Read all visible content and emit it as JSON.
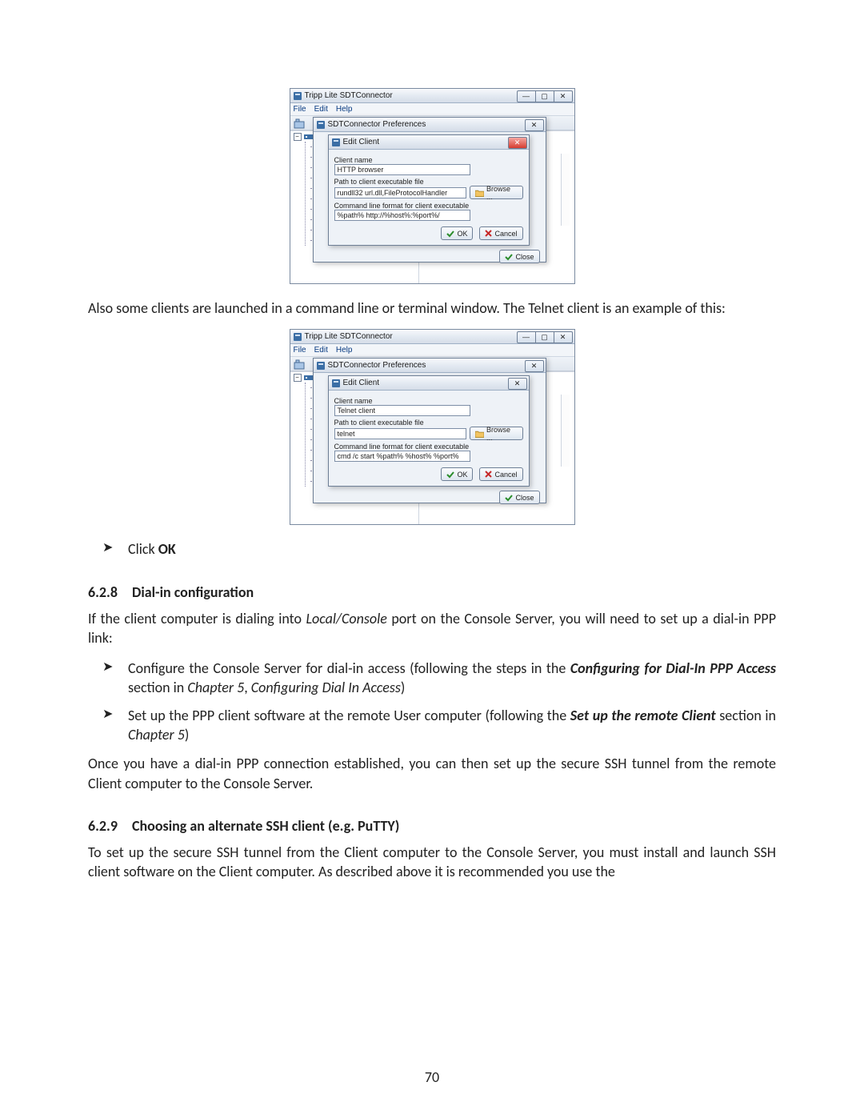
{
  "page_number": "70",
  "text": {
    "para1": "Also some clients are launched in a command line or terminal window. The Telnet client is an example of this:",
    "click_prefix": "Click ",
    "click_bold": "OK",
    "para2_a": "If the client computer is dialing into ",
    "para2_italic": "Local/Console",
    "para2_b": " port on the Console Server, you will need to set up a dial-in PPP link:",
    "para3": "Once you have a dial-in PPP connection established, you can then set up the secure SSH tunnel from the remote Client computer to the Console Server.",
    "para4": "To set up the secure SSH tunnel from the Client computer to the Console Server, you must install and launch SSH client software on the Client computer. As described above it is recommended you use the",
    "b1_a": "Configure the Console Server for dial-in access (following the steps in the ",
    "b1_bi": "Configuring for Dial-In PPP Access",
    "b1_b": " section in ",
    "b1_i1": "Chapter 5",
    "b1_c": ", ",
    "b1_i2": "Configuring Dial In Access",
    "b1_d": ")",
    "b2_a": "Set up the PPP client software at the remote User computer (following the ",
    "b2_bi": "Set up the remote Client",
    "b2_b": " section in ",
    "b2_i": "Chapter 5",
    "b2_c": ")",
    "h628_num": "6.2.8",
    "h628_text": "Dial-in configuration",
    "h629_num": "6.2.9",
    "h629_text": "Choosing an alternate SSH client (e.g. PuTTY)"
  },
  "screenshot": {
    "app_title": "Tripp Lite SDTConnector",
    "menu": {
      "file": "File",
      "edit": "Edit",
      "help": "Help"
    },
    "prefs_title": "SDTConnector Preferences",
    "edit_client_title": "Edit Client",
    "labels": {
      "client_name": "Client name",
      "path": "Path to client executable file",
      "cmdline": "Command line format for client executable"
    },
    "buttons": {
      "browse": "Browse ...",
      "ok": "OK",
      "cancel": "Cancel",
      "close": "Close"
    },
    "win_glyphs": {
      "min": "—",
      "max": "▢",
      "close": "✕"
    }
  },
  "screenshot1": {
    "client_name_value": "HTTP browser",
    "path_value": "rundll32 url.dll,FileProtocolHandler",
    "cmdline_value": "%path% http://%host%:%port%/"
  },
  "screenshot2": {
    "client_name_value": "Telnet client",
    "path_value": "telnet",
    "cmdline_value": "cmd /c start %path% %host% %port%"
  }
}
